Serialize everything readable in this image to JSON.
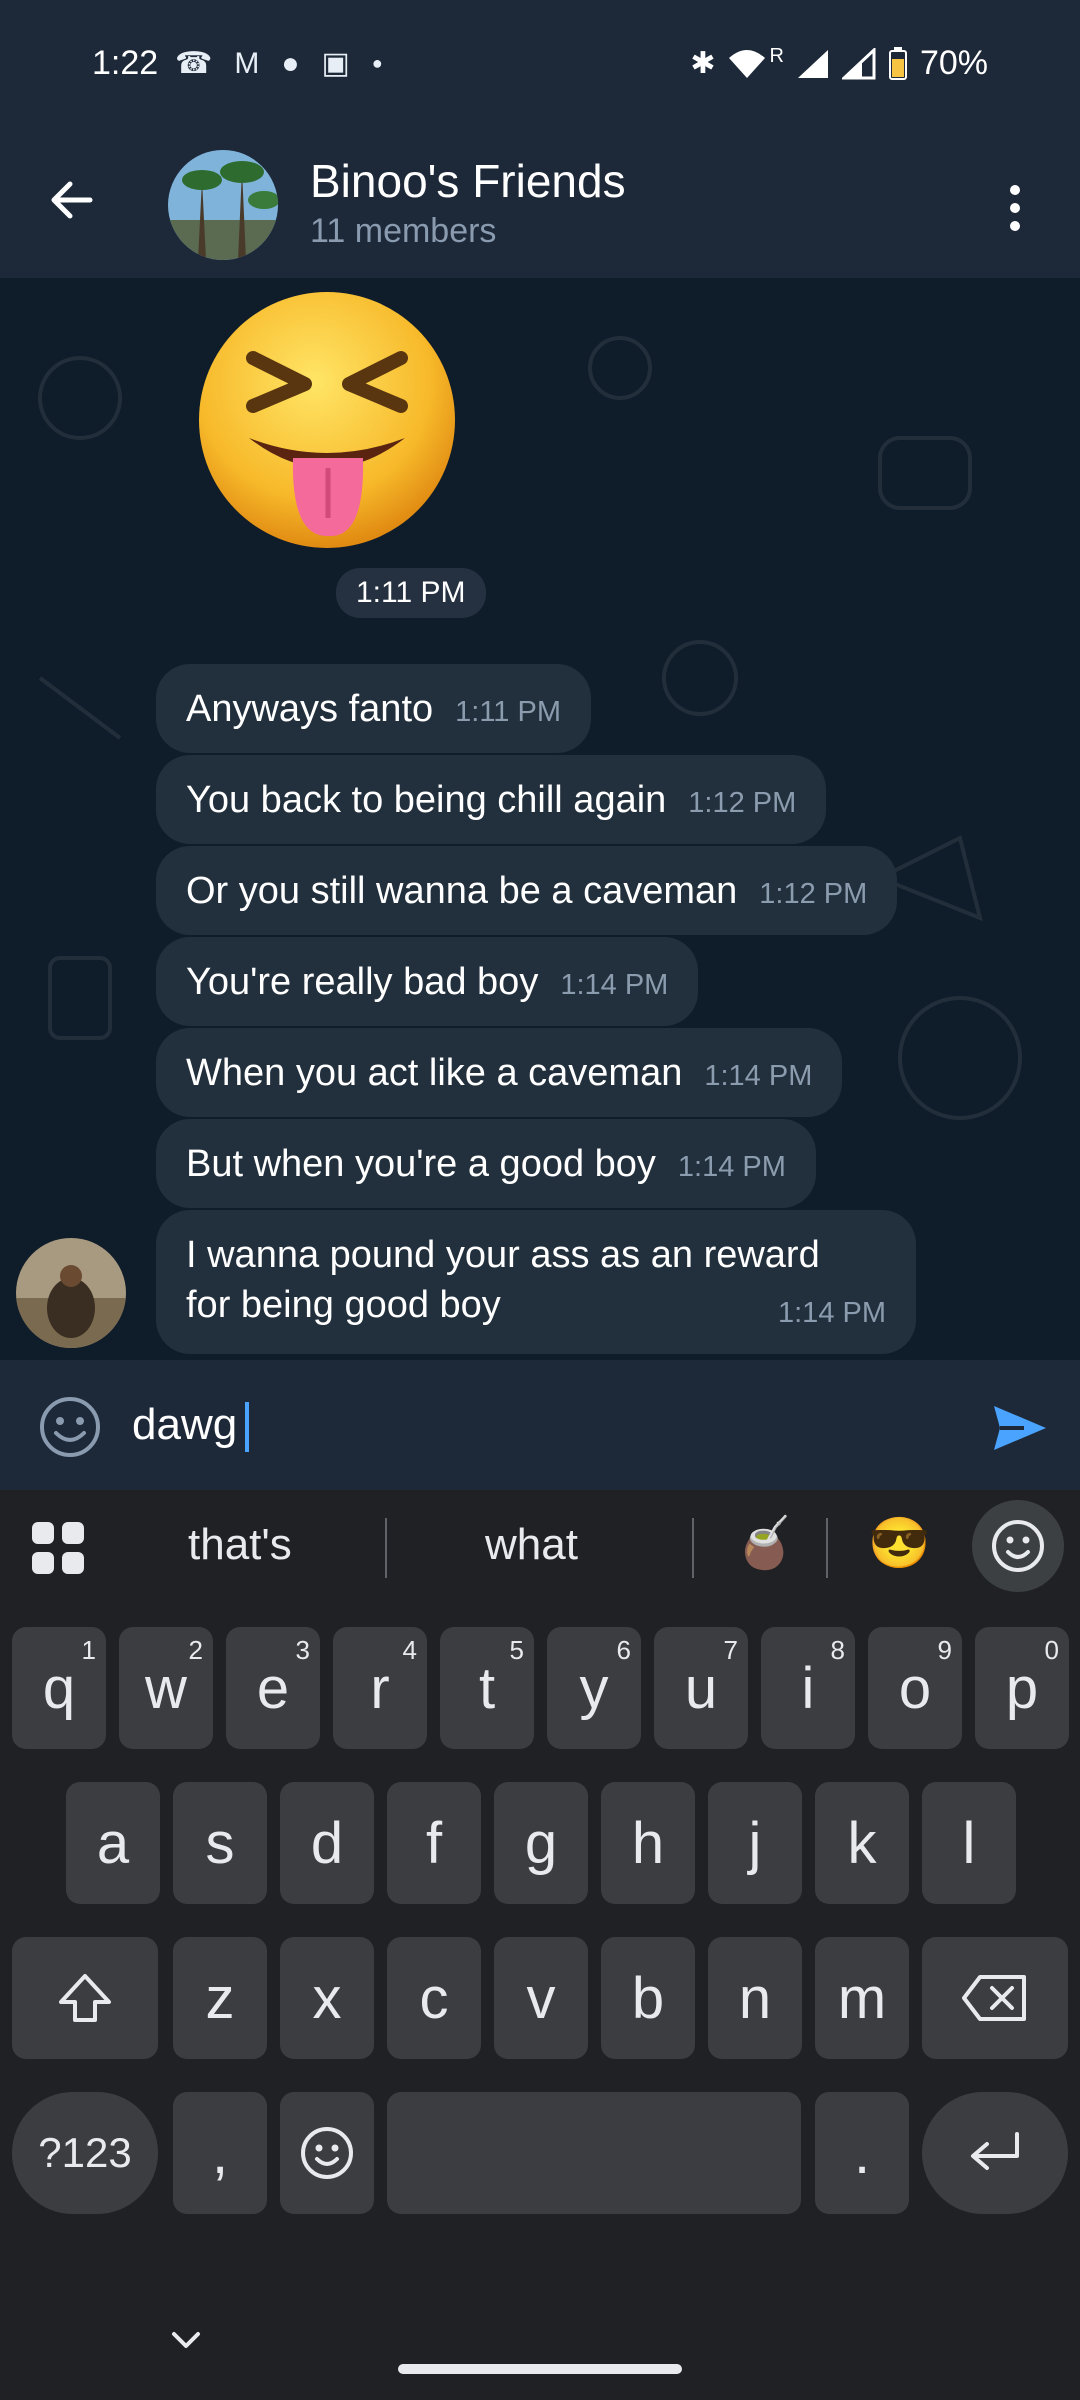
{
  "status_bar": {
    "time": "1:22",
    "battery": "70%",
    "roaming": "R"
  },
  "app_bar": {
    "title": "Binoo's Friends",
    "subtitle": "11 members"
  },
  "chat": {
    "sticker_time": "1:11 PM",
    "messages": [
      {
        "text": "Anyways fanto",
        "time": "1:11 PM"
      },
      {
        "text": "You back to being chill again",
        "time": "1:12 PM"
      },
      {
        "text": "Or you still wanna be a caveman",
        "time": "1:12 PM"
      },
      {
        "text": "You're really bad boy",
        "time": "1:14 PM"
      },
      {
        "text": "When you act like a caveman",
        "time": "1:14 PM"
      },
      {
        "text": "But when you're a good boy",
        "time": "1:14 PM"
      },
      {
        "text_line1": "I wanna pound your ass as an reward",
        "text_line2": "for being good boy",
        "time": "1:14 PM"
      }
    ]
  },
  "input": {
    "value": "dawg"
  },
  "keyboard": {
    "suggestions": [
      "that's",
      "what"
    ],
    "suggestion_emojis": [
      "🧉",
      "😎"
    ],
    "row1": [
      {
        "k": "q",
        "h": "1"
      },
      {
        "k": "w",
        "h": "2"
      },
      {
        "k": "e",
        "h": "3"
      },
      {
        "k": "r",
        "h": "4"
      },
      {
        "k": "t",
        "h": "5"
      },
      {
        "k": "y",
        "h": "6"
      },
      {
        "k": "u",
        "h": "7"
      },
      {
        "k": "i",
        "h": "8"
      },
      {
        "k": "o",
        "h": "9"
      },
      {
        "k": "p",
        "h": "0"
      }
    ],
    "row2": [
      "a",
      "s",
      "d",
      "f",
      "g",
      "h",
      "j",
      "k",
      "l"
    ],
    "row3": [
      "z",
      "x",
      "c",
      "v",
      "b",
      "n",
      "m"
    ],
    "symbols_key": "?123",
    "comma_key": ",",
    "period_key": "."
  },
  "colors": {
    "header_bg": "#1d2939",
    "bubble_bg": "#222f3c",
    "accent": "#4aa3ff"
  }
}
